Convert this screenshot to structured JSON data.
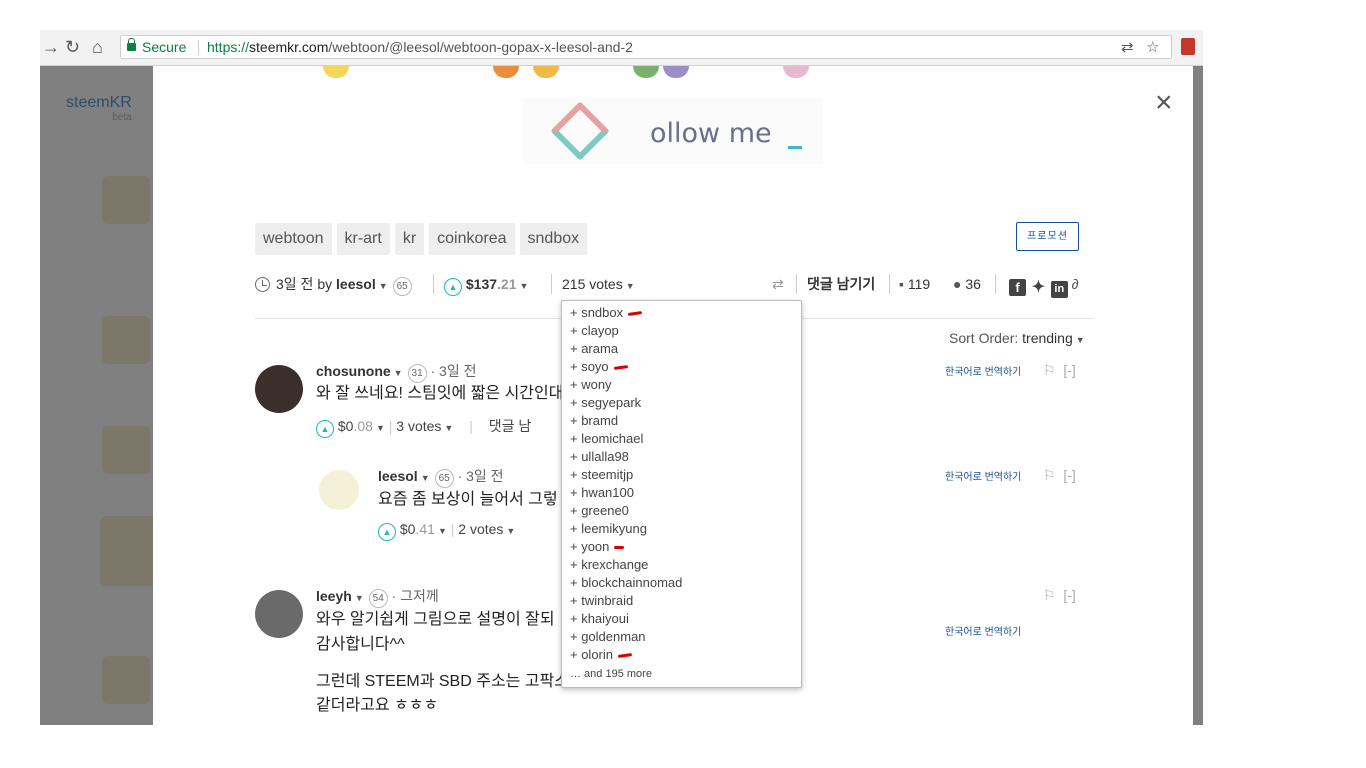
{
  "browser": {
    "secure_label": "Secure",
    "url_scheme": "https://",
    "url_host": "steemkr.com",
    "url_path": "/webtoon/@leesol/webtoon-gopax-x-leesol-and-2"
  },
  "background": {
    "logo": "steemKR",
    "logo_sub": "beta"
  },
  "banner": {
    "text": "ollow me"
  },
  "tags": [
    "webtoon",
    "kr-art",
    "kr",
    "coinkorea",
    "sndbox"
  ],
  "promote_label": "프로모션",
  "post": {
    "time": "3일 전 by",
    "author": "leesol",
    "reputation": "65",
    "payout_main": "$137",
    "payout_cents": ".21",
    "votes": "215 votes",
    "comment_action": "댓글 남기기",
    "comment_count": "119",
    "views": "36"
  },
  "sort": {
    "label": "Sort Order:",
    "value": "trending"
  },
  "comments": [
    {
      "author": "chosunone",
      "reputation": "31",
      "time": "· 3일 전",
      "body": "와 잘 쓰네요! 스팀잇에 짧은 시간인대",
      "payout_main": "$0",
      "payout_cents": ".08",
      "votes": "3 votes",
      "reply": "댓글 남",
      "translate": "한국어로 번역하기",
      "collapse": "[-]"
    },
    {
      "author": "leesol",
      "reputation": "65",
      "time": "· 3일 전",
      "body": "요즘 좀 보상이 늘어서 그렇",
      "payout_main": "$0",
      "payout_cents": ".41",
      "votes": "2 votes",
      "translate": "한국어로 번역하기",
      "collapse": "[-]"
    },
    {
      "author": "leeyh",
      "reputation": "54",
      "time": "· 그저께",
      "body_lines": [
        "와우 알기쉽게 그림으로 설명이 잘되",
        "감사합니다^^",
        "그런데 STEEM과 SBD 주소는 고팍스",
        "같더라고요 ㅎㅎㅎ"
      ],
      "translate": "한국어로 번역하기",
      "collapse": "[-]"
    }
  ],
  "voters": [
    {
      "name": "+ sndbox",
      "marked": true
    },
    {
      "name": "+ clayop",
      "marked": false
    },
    {
      "name": "+ arama",
      "marked": false
    },
    {
      "name": "+ soyo",
      "marked": true
    },
    {
      "name": "+ wony",
      "marked": false
    },
    {
      "name": "+ segyepark",
      "marked": false
    },
    {
      "name": "+ bramd",
      "marked": false
    },
    {
      "name": "+ leomichael",
      "marked": false
    },
    {
      "name": "+ ullalla98",
      "marked": false
    },
    {
      "name": "+ steemitjp",
      "marked": false
    },
    {
      "name": "+ hwan100",
      "marked": false
    },
    {
      "name": "+ greene0",
      "marked": false
    },
    {
      "name": "+ leemikyung",
      "marked": false
    },
    {
      "name": "+ yoon",
      "marked": true
    },
    {
      "name": "+ krexchange",
      "marked": false
    },
    {
      "name": "+ blockchainnomad",
      "marked": false
    },
    {
      "name": "+ twinbraid",
      "marked": false
    },
    {
      "name": "+ khaiyoui",
      "marked": false
    },
    {
      "name": "+ goldenman",
      "marked": false
    },
    {
      "name": "+ olorin",
      "marked": true
    }
  ],
  "voters_more": "… and 195 more",
  "colors": {
    "accent": "#1fb6c0",
    "link": "#1a5099",
    "secure": "#0b8043",
    "annotation": "#d90000"
  }
}
